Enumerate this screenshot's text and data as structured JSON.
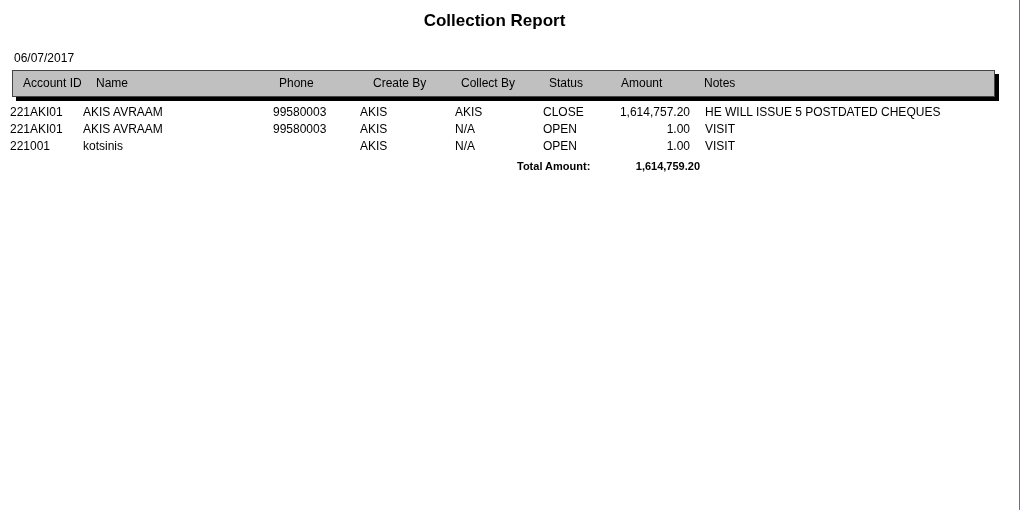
{
  "title": "Collection Report",
  "date": "06/07/2017",
  "columns": [
    "Account ID",
    "Name",
    "Phone",
    "Create By",
    "Collect By",
    "Status",
    "Amount",
    "Notes"
  ],
  "rows": [
    {
      "cells": [
        "221AKI01",
        "AKIS AVRAAM",
        "99580003",
        "AKIS",
        "AKIS",
        "CLOSE",
        "1,614,757.20",
        "HE WILL ISSUE 5 POSTDATED CHEQUES"
      ]
    },
    {
      "cells": [
        "221AKI01",
        "AKIS AVRAAM",
        "99580003",
        "AKIS",
        "N/A",
        "OPEN",
        "1.00",
        "VISIT"
      ]
    },
    {
      "cells": [
        "221001",
        "kotsinis",
        "",
        "AKIS",
        "N/A",
        "OPEN",
        "1.00",
        "VISIT"
      ]
    }
  ],
  "total": {
    "label": "Total Amount:",
    "value": "1,614,759.20"
  }
}
